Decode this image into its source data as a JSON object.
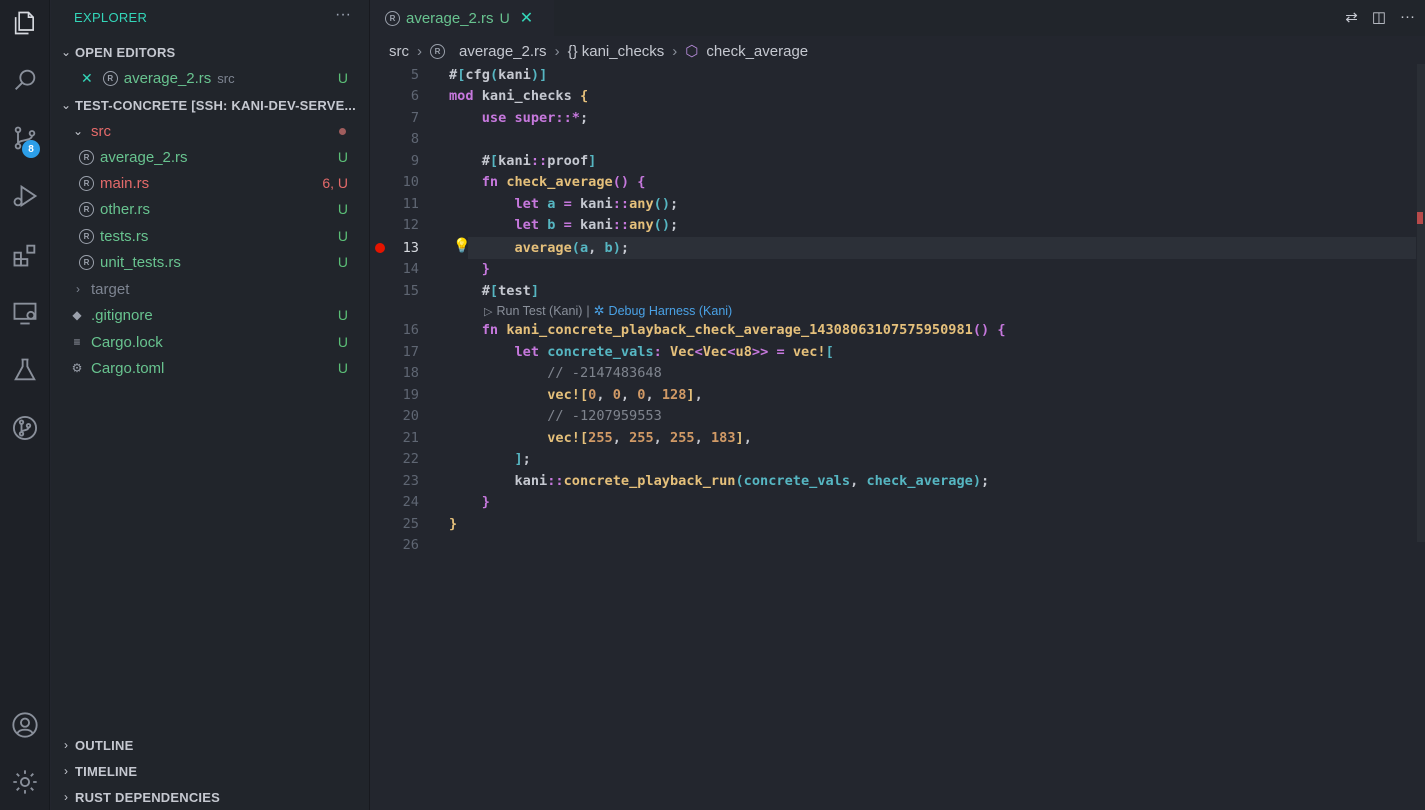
{
  "activity": {
    "icons": [
      "explorer-icon",
      "search-icon",
      "source-control-icon",
      "run-debug-icon",
      "extensions-icon",
      "remote-explorer-icon",
      "testing-icon",
      "git-graph-icon",
      "account-icon",
      "settings-gear-icon"
    ],
    "scm_badge": "8"
  },
  "sidebar": {
    "title": "EXPLORER",
    "more": "···",
    "open_editors": {
      "header": "OPEN EDITORS",
      "items": [
        {
          "name": "average_2.rs",
          "folder": "src",
          "status": "U"
        }
      ]
    },
    "workspace": {
      "header": "TEST-CONCRETE [SSH: KANI-DEV-SERVE...",
      "src_folder": "src",
      "files": [
        {
          "name": "average_2.rs",
          "status": "U"
        },
        {
          "name": "main.rs",
          "status": "6, U"
        },
        {
          "name": "other.rs",
          "status": "U"
        },
        {
          "name": "tests.rs",
          "status": "U"
        },
        {
          "name": "unit_tests.rs",
          "status": "U"
        }
      ],
      "target": "target",
      "gitignore": {
        "name": ".gitignore",
        "status": "U"
      },
      "cargo_lock": {
        "name": "Cargo.lock",
        "status": "U"
      },
      "cargo_toml": {
        "name": "Cargo.toml",
        "status": "U"
      }
    },
    "outline": "OUTLINE",
    "timeline": "TIMELINE",
    "rust_deps": "RUST DEPENDENCIES"
  },
  "editor": {
    "tab": {
      "name": "average_2.rs",
      "status": "U",
      "close": "✕"
    },
    "breadcrumb": [
      "src",
      "average_2.rs",
      "{} kani_checks",
      "check_average"
    ],
    "line_numbers": [
      "5",
      "6",
      "7",
      "8",
      "9",
      "10",
      "11",
      "12",
      "13",
      "14",
      "15",
      "16",
      "17",
      "18",
      "19",
      "20",
      "21",
      "22",
      "23",
      "24",
      "25",
      "26"
    ],
    "codelens": {
      "run": "Run Test (Kani)",
      "sep": "|",
      "debug": "Debug Harness (Kani)"
    },
    "comments": {
      "c18": "// -2147483648",
      "c20": "// -1207959553"
    },
    "numbers": {
      "v19": [
        "0",
        "0",
        "0",
        "128"
      ],
      "v21": [
        "255",
        "255",
        "255",
        "183"
      ]
    },
    "ident": {
      "harness": "kani_concrete_playback_check_average_14308063107575950981",
      "check": "check_average",
      "mod": "kani_checks",
      "playback": "concrete_playback_run",
      "vals": "concrete_vals"
    }
  }
}
